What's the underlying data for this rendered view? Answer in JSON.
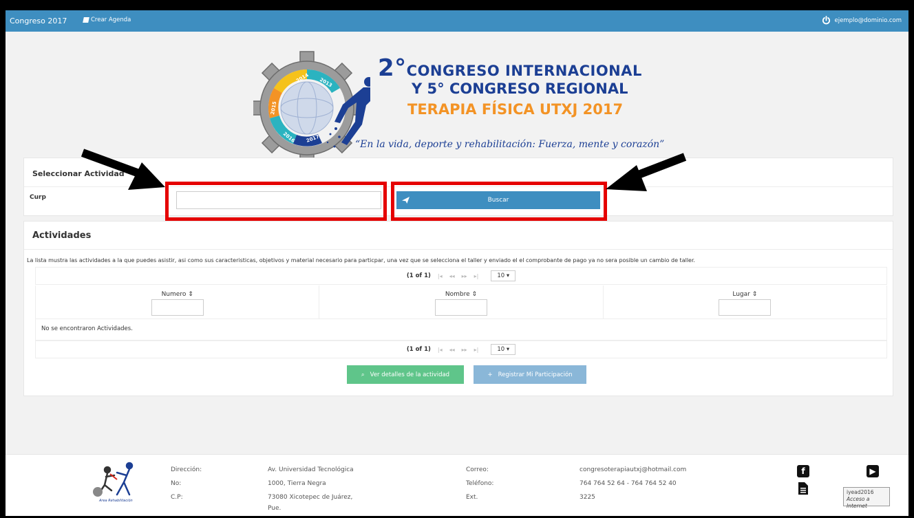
{
  "navbar": {
    "brand": "Congreso 2017",
    "agenda_link": "Crear Agenda",
    "user_email": "ejemplo@dominio.com"
  },
  "banner": {
    "line1_number": "2°",
    "line1_rest": "CONGRESO INTERNACIONAL",
    "line2": "Y 5° CONGRESO REGIONAL",
    "line3": "TERAPIA FÍSICA UTXJ 2017",
    "slogan": "“En la vida, deporte y rehabilitación: Fuerza, mente y corazón”",
    "gear_years": [
      "2014",
      "2013",
      "2015",
      "2016",
      "2017"
    ],
    "colors": {
      "blue": "#1c3f94",
      "orange": "#f39325"
    }
  },
  "select_panel": {
    "title": "Seleccionar Actividad",
    "curp_label": "Curp",
    "curp_value": "",
    "search_button": "Buscar"
  },
  "activities_panel": {
    "title": "Actividades",
    "description": "La lista mustra las actividades a la que puedes asistir, asi como sus caracteristicas, objetivos y material necesario para particpar, una vez que se selecciona el taller y enviado el el comprobante de pago ya no sera posible un cambio de taller.",
    "pager": {
      "current": "(1 of 1)",
      "page_size": "10"
    },
    "columns": [
      "Numero",
      "Nombre",
      "Lugar"
    ],
    "empty_message": "No se encontraron Actividades.",
    "details_button": "Ver detalles de la actividad",
    "register_button": "Registrar Mi Participación"
  },
  "footer": {
    "labels_left": [
      "Dirección:",
      "No:",
      "C.P:"
    ],
    "values_left": [
      "Av. Universidad Tecnológica",
      "1000, Tierra Negra",
      "73080 Xicotepec de Juárez,",
      "Pue."
    ],
    "labels_right": [
      "Correo:",
      "Teléfono:",
      "Ext."
    ],
    "values_right": [
      "congresoterapiautxj@hotmail.com",
      "764 764 52 64 - 764 764 52 40",
      "3225"
    ],
    "logo_caption": "Area Rehabilitación",
    "activation_line1": "iyead2016",
    "activation_line2": "Acceso a Internet"
  },
  "colors": {
    "navbar": "#3e8ec0",
    "primary_button": "#3e8ec0",
    "success_button": "#5fc58a",
    "annotation_red": "#e50000"
  }
}
